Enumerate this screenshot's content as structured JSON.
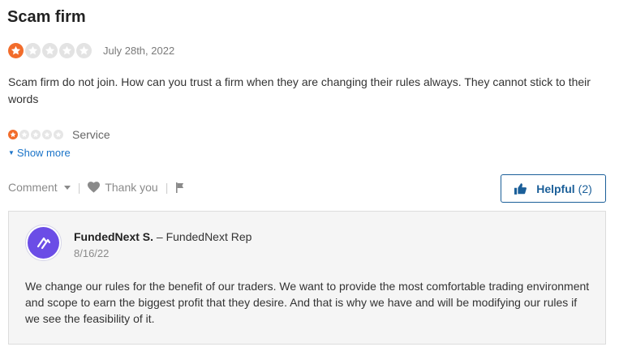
{
  "review": {
    "title": "Scam firm",
    "rating": 1,
    "max_rating": 5,
    "date": "July 28th, 2022",
    "body": "Scam firm do not join. How can you trust a firm when they are changing their rules always. They cannot stick to their words",
    "sub_rating": {
      "label": "Service",
      "rating": 1,
      "max_rating": 5
    },
    "show_more": "Show more"
  },
  "actions": {
    "comment": "Comment",
    "thank_you": "Thank you",
    "helpful_label": "Helpful",
    "helpful_count": "(2)"
  },
  "reply": {
    "author": "FundedNext S.",
    "role": "– FundedNext Rep",
    "date": "8/16/22",
    "body": "We change our rules for the benefit of our traders. We want to provide the most comfortable trading environment and scope to earn the biggest profit that they desire. And that is why we have and will be modifying our rules if we see the feasibility of it."
  },
  "colors": {
    "star_on": "#f26c2b",
    "star_off": "#e3e3e3",
    "link": "#1a73c8",
    "helpful_border": "#1b5f99",
    "avatar_bg": "#6b4de6"
  },
  "icons": [
    "star-icon",
    "chevron-down-icon",
    "heart-icon",
    "flag-icon",
    "thumbs-up-icon",
    "company-logo-icon"
  ]
}
